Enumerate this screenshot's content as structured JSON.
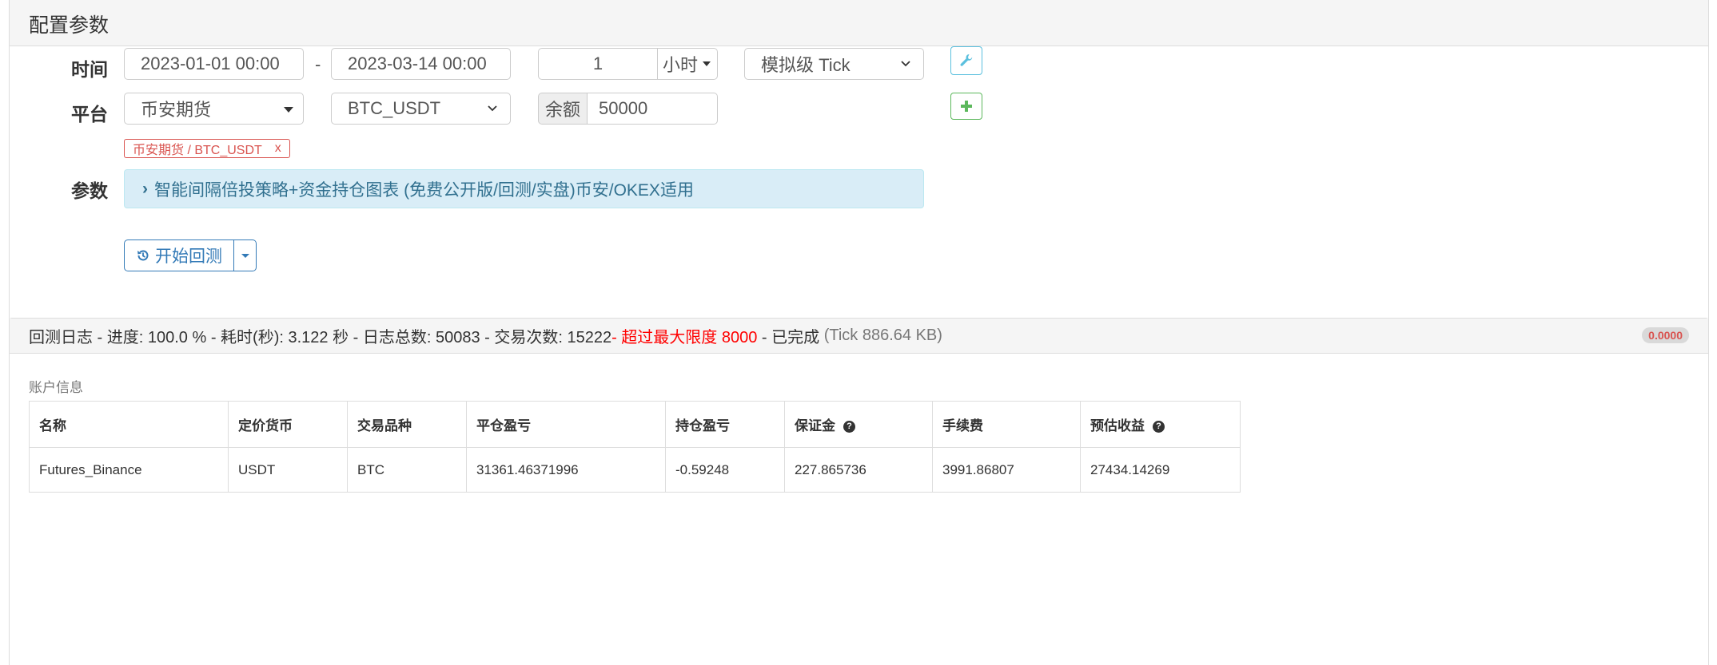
{
  "config_panel": {
    "title": "配置参数",
    "labels": {
      "time": "时间",
      "platform": "平台",
      "params": "参数"
    },
    "start_date": "2023-01-01 00:00",
    "range_sep": "-",
    "end_date": "2023-03-14 00:00",
    "period_value": "1",
    "period_unit": "小时",
    "tick_mode": "模拟级 Tick",
    "exchange": "币安期货",
    "pair": "BTC_USDT",
    "balance_label": "余额",
    "balance_value": "50000",
    "tag": {
      "text": "币安期货 / BTC_USDT",
      "remove": "x"
    },
    "strategy_title": "智能间隔倍投策略+资金持仓图表 (免费公开版/回测/实盘)币安/OKEX适用",
    "run_button": "开始回测",
    "icons": {
      "settings": "wrench-icon",
      "add": "plus-icon",
      "history": "history-icon"
    },
    "colors": {
      "info_bg": "#d9edf7",
      "info_text": "#31708f",
      "primary": "#337ab7",
      "success": "#5cb85c",
      "danger": "#d9534f"
    }
  },
  "log_panel": {
    "header_main": "回测日志 - 进度: 100.0 % - 耗时(秒): 3.122 秒 - 日志总数: 50083 - 交易次数: 15222",
    "header_warning": " - 超过最大限度 8000",
    "header_done": " - 已完成 ",
    "header_tick": "(Tick 886.64 KB)",
    "badge": "0.0000",
    "section_label": "账户信息",
    "columns": [
      "名称",
      "定价货币",
      "交易品种",
      "平仓盈亏",
      "持仓盈亏",
      "保证金",
      "手续费",
      "预估收益"
    ],
    "row": [
      "Futures_Binance",
      "USDT",
      "BTC",
      "31361.46371996",
      "-0.59248",
      "227.865736",
      "3991.86807",
      "27434.14269"
    ]
  }
}
